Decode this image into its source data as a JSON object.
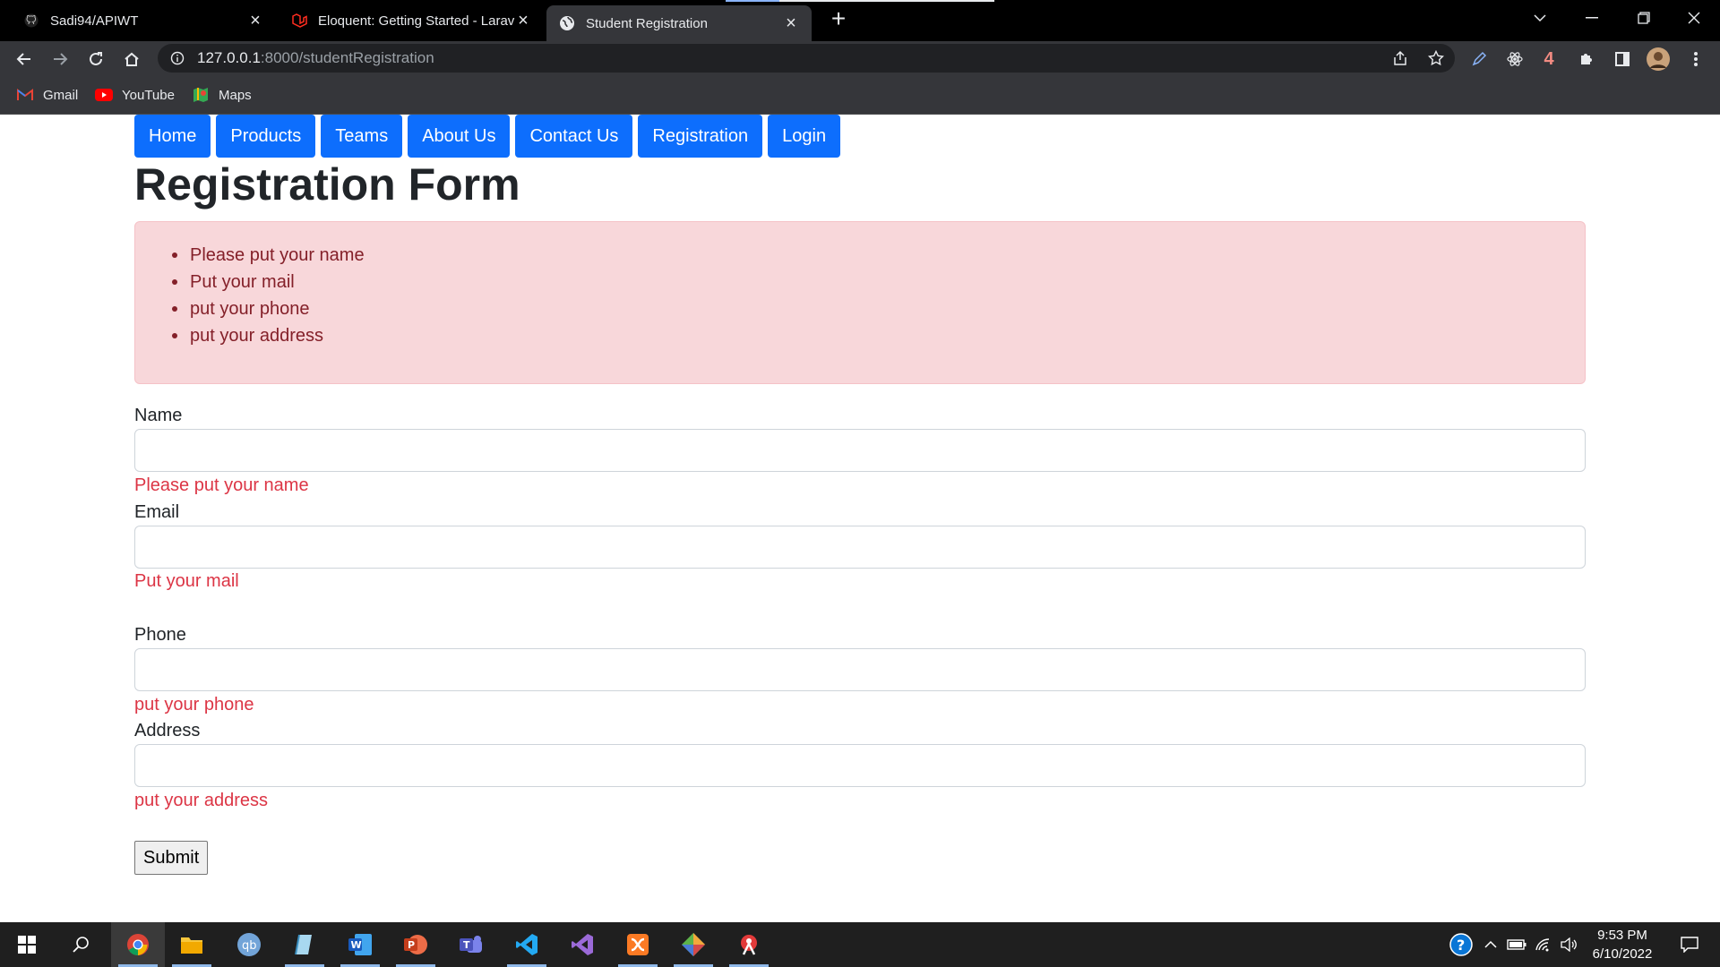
{
  "browser": {
    "tabs": [
      {
        "title": "Sadi94/APIWT",
        "icon": "github-icon",
        "active": false
      },
      {
        "title": "Eloquent: Getting Started - Larav",
        "icon": "laravel-icon",
        "active": false
      },
      {
        "title": "Student Registration",
        "icon": "globe-icon",
        "active": true
      }
    ],
    "url_host": "127.0.0.1",
    "url_path": ":8000/studentRegistration",
    "extension_badge": "4",
    "bookmarks": [
      {
        "label": "Gmail",
        "icon": "gmail-icon"
      },
      {
        "label": "YouTube",
        "icon": "youtube-icon"
      },
      {
        "label": "Maps",
        "icon": "maps-icon"
      }
    ]
  },
  "nav": {
    "items": [
      "Home",
      "Products",
      "Teams",
      "About Us",
      "Contact Us",
      "Registration",
      "Login"
    ],
    "color": "#0d6efd"
  },
  "page": {
    "title": "Registration Form",
    "alert_errors": [
      "Please put your name",
      "Put your mail",
      "put your phone",
      "put your address"
    ],
    "form": {
      "name_label": "Name",
      "name_value": "",
      "name_error": "Please put your name",
      "email_label": "Email",
      "email_value": "",
      "email_error": "Put your mail",
      "phone_label": "Phone",
      "phone_value": "",
      "phone_error": "put your phone",
      "address_label": "Address",
      "address_value": "",
      "address_error": "put your address",
      "submit_label": "Submit"
    },
    "error_color": "#dc3545",
    "alert_bg": "#f8d7da"
  },
  "taskbar": {
    "time": "9:53 PM",
    "date": "6/10/2022",
    "apps": [
      "windows-start-icon",
      "search-icon",
      "chrome-icon",
      "file-explorer-icon",
      "qbittorrent-icon",
      "notepad-icon",
      "word-icon",
      "powerpoint-icon",
      "teams-icon",
      "vscode-icon",
      "visual-studio-icon",
      "xampp-icon",
      "git-icon",
      "snipping-tool-icon"
    ]
  }
}
